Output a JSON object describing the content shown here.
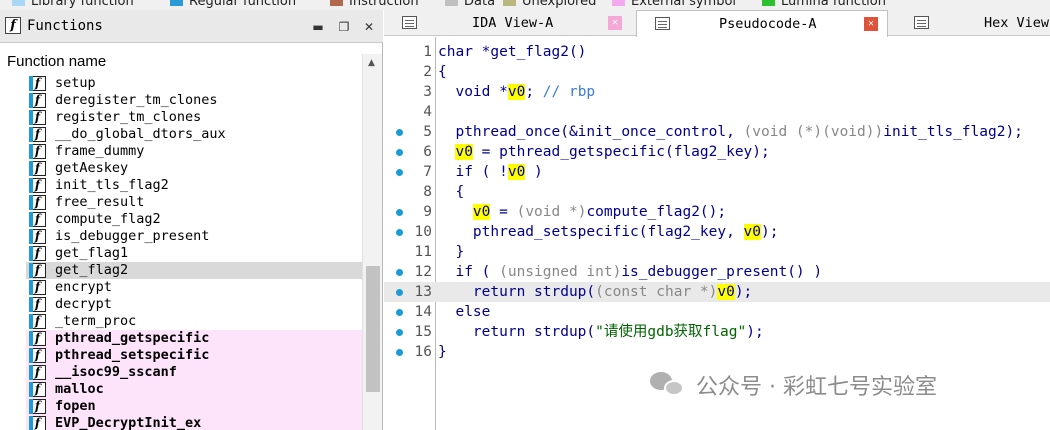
{
  "legend": [
    {
      "label": "Library function",
      "color": "#a8d8f5"
    },
    {
      "label": "Regular function",
      "color": "#2a9bd6"
    },
    {
      "label": "Instruction",
      "color": "#b0694a"
    },
    {
      "label": "Data",
      "color": "#c0c0c0"
    },
    {
      "label": "Unexplored",
      "color": "#b8b880"
    },
    {
      "label": "External symbol",
      "color": "#f4a8f0"
    },
    {
      "label": "Lumina function",
      "color": "#2ec12e"
    }
  ],
  "functions_panel": {
    "title": "Functions",
    "column_header": "Function name",
    "items": [
      {
        "name": "setup"
      },
      {
        "name": "deregister_tm_clones"
      },
      {
        "name": "register_tm_clones"
      },
      {
        "name": "__do_global_dtors_aux"
      },
      {
        "name": "frame_dummy"
      },
      {
        "name": "getAeskey"
      },
      {
        "name": "init_tls_flag2"
      },
      {
        "name": "free_result"
      },
      {
        "name": "compute_flag2"
      },
      {
        "name": "is_debugger_present"
      },
      {
        "name": "get_flag1"
      },
      {
        "name": "get_flag2",
        "selected": true
      },
      {
        "name": "encrypt"
      },
      {
        "name": "decrypt"
      },
      {
        "name": "_term_proc"
      },
      {
        "name": "pthread_getspecific",
        "external": true
      },
      {
        "name": "pthread_setspecific",
        "external": true
      },
      {
        "name": "__isoc99_sscanf",
        "external": true
      },
      {
        "name": "malloc",
        "external": true
      },
      {
        "name": "fopen",
        "external": true
      },
      {
        "name": "EVP_DecryptInit_ex",
        "external": true
      }
    ]
  },
  "tabs": [
    {
      "label": "IDA View-A",
      "active": false
    },
    {
      "label": "Pseudocode-A",
      "active": true
    },
    {
      "label": "Hex View-"
    }
  ],
  "code": {
    "lines": [
      {
        "n": "1",
        "bp": false,
        "hl": false,
        "tokens": [
          [
            "kw",
            "char *get_flag2()"
          ]
        ]
      },
      {
        "n": "2",
        "bp": false,
        "hl": false,
        "tokens": [
          [
            "kw",
            "{"
          ]
        ]
      },
      {
        "n": "3",
        "bp": false,
        "hl": false,
        "tokens": [
          [
            "kw",
            "  void *"
          ],
          [
            "var",
            "v0"
          ],
          [
            "kw",
            "; "
          ],
          [
            "cmt",
            "// rbp"
          ]
        ]
      },
      {
        "n": "4",
        "bp": false,
        "hl": false,
        "tokens": []
      },
      {
        "n": "5",
        "bp": true,
        "hl": false,
        "tokens": [
          [
            "kw",
            "  pthread_once(&init_once_control, "
          ],
          [
            "type",
            "(void (*)(void))"
          ],
          [
            "kw",
            "init_tls_flag2);"
          ]
        ]
      },
      {
        "n": "6",
        "bp": true,
        "hl": false,
        "tokens": [
          [
            "kw",
            "  "
          ],
          [
            "var",
            "v0"
          ],
          [
            "kw",
            " = pthread_getspecific(flag2_key);"
          ]
        ]
      },
      {
        "n": "7",
        "bp": true,
        "hl": false,
        "tokens": [
          [
            "kw",
            "  if ( !"
          ],
          [
            "var",
            "v0"
          ],
          [
            "kw",
            " )"
          ]
        ]
      },
      {
        "n": "8",
        "bp": false,
        "hl": false,
        "tokens": [
          [
            "kw",
            "  {"
          ]
        ]
      },
      {
        "n": "9",
        "bp": true,
        "hl": false,
        "tokens": [
          [
            "kw",
            "    "
          ],
          [
            "var",
            "v0"
          ],
          [
            "kw",
            " = "
          ],
          [
            "type",
            "(void *)"
          ],
          [
            "kw",
            "compute_flag2();"
          ]
        ]
      },
      {
        "n": "10",
        "bp": true,
        "hl": false,
        "tokens": [
          [
            "kw",
            "    pthread_setspecific(flag2_key, "
          ],
          [
            "var",
            "v0"
          ],
          [
            "kw",
            ");"
          ]
        ]
      },
      {
        "n": "11",
        "bp": false,
        "hl": false,
        "tokens": [
          [
            "kw",
            "  }"
          ]
        ]
      },
      {
        "n": "12",
        "bp": true,
        "hl": false,
        "tokens": [
          [
            "kw",
            "  if ( "
          ],
          [
            "type",
            "(unsigned int)"
          ],
          [
            "kw",
            "is_debugger_present() )"
          ]
        ]
      },
      {
        "n": "13",
        "bp": true,
        "hl": true,
        "tokens": [
          [
            "kw",
            "    return strdup("
          ],
          [
            "type",
            "(const char *)"
          ],
          [
            "var",
            "v0"
          ],
          [
            "kw",
            ");"
          ]
        ]
      },
      {
        "n": "14",
        "bp": true,
        "hl": false,
        "tokens": [
          [
            "kw",
            "  else"
          ]
        ]
      },
      {
        "n": "15",
        "bp": true,
        "hl": false,
        "tokens": [
          [
            "kw",
            "    return strdup("
          ],
          [
            "str",
            "\"请使用gdb获取flag\""
          ],
          [
            "kw",
            ");"
          ]
        ]
      },
      {
        "n": "16",
        "bp": true,
        "hl": false,
        "tokens": [
          [
            "kw",
            "}"
          ]
        ]
      }
    ]
  },
  "watermark": {
    "text": "公众号 · 彩虹七号实验室"
  }
}
